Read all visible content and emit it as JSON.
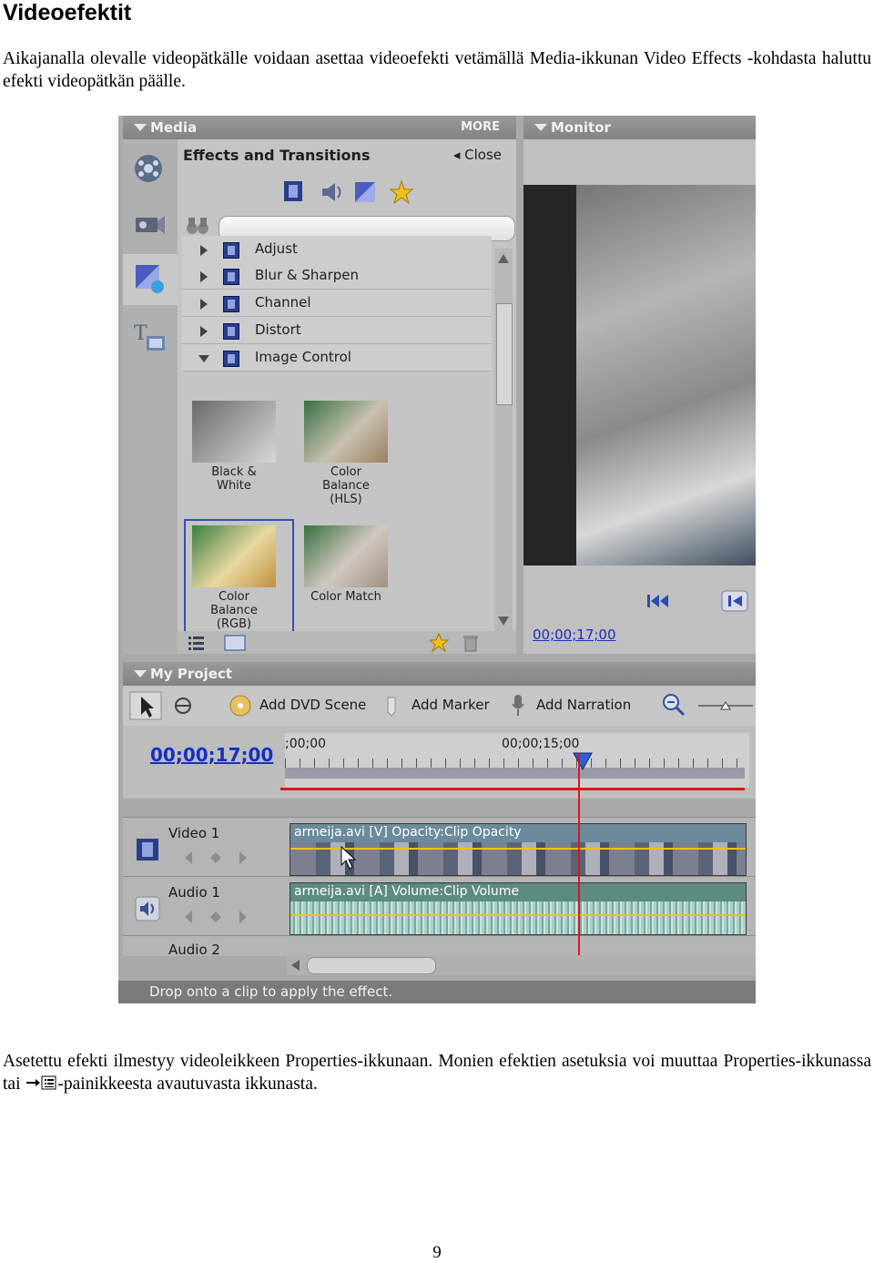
{
  "page": {
    "heading": "Videoefektit",
    "intro": "Aikajanalla olevalle videopätkälle voidaan asettaa videoefekti vetämällä Media-ikkunan Video Effects -kohdasta haluttu efekti videopätkän päälle.",
    "outro_before": "Asetettu efekti ilmestyy videoleikkeen Properties-ikkunaan. Monien efektien asetuksia voi muuttaa Properties-ikkunassa tai ",
    "outro_after": "-painikkeesta avautuvasta ikkunasta.",
    "page_number": "9"
  },
  "screenshot": {
    "media_title": "Media",
    "more_label": "MORE",
    "monitor_title": "Monitor",
    "effects_title": "Effects and Transitions",
    "close_label": "Close",
    "categories": [
      {
        "label": "Adjust",
        "open": false
      },
      {
        "label": "Blur & Sharpen",
        "open": false
      },
      {
        "label": "Channel",
        "open": false
      },
      {
        "label": "Distort",
        "open": false
      },
      {
        "label": "Image Control",
        "open": true
      }
    ],
    "effects": [
      {
        "line1": "Black &",
        "line2": "White",
        "line3": ""
      },
      {
        "line1": "Color",
        "line2": "Balance",
        "line3": "(HLS)"
      },
      {
        "line1": "Color",
        "line2": "Balance",
        "line3": "(RGB)"
      },
      {
        "line1": "Color Match",
        "line2": "",
        "line3": ""
      }
    ],
    "monitor_time": "00;00;17;00",
    "project_title": "My Project",
    "toolbar": {
      "add_dvd_scene": "Add DVD Scene",
      "add_marker": "Add Marker",
      "add_narration": "Add Narration"
    },
    "current_time": "00;00;17;00",
    "ruler_start": ";00;00",
    "ruler_mid": "00;00;15;00",
    "tracks": [
      {
        "name": "Video 1",
        "clip_label": "armeija.avi [V] Opacity:Clip Opacity"
      },
      {
        "name": "Audio 1",
        "clip_label": "armeija.avi [A] Volume:Clip Volume"
      }
    ],
    "audio2_partial": "Audio 2",
    "status_text": "Drop onto a clip to apply the effect."
  },
  "colors": {
    "timecode_blue": "#1530c0",
    "playhead_red": "#d81818",
    "selection_blue": "#3050b8"
  }
}
